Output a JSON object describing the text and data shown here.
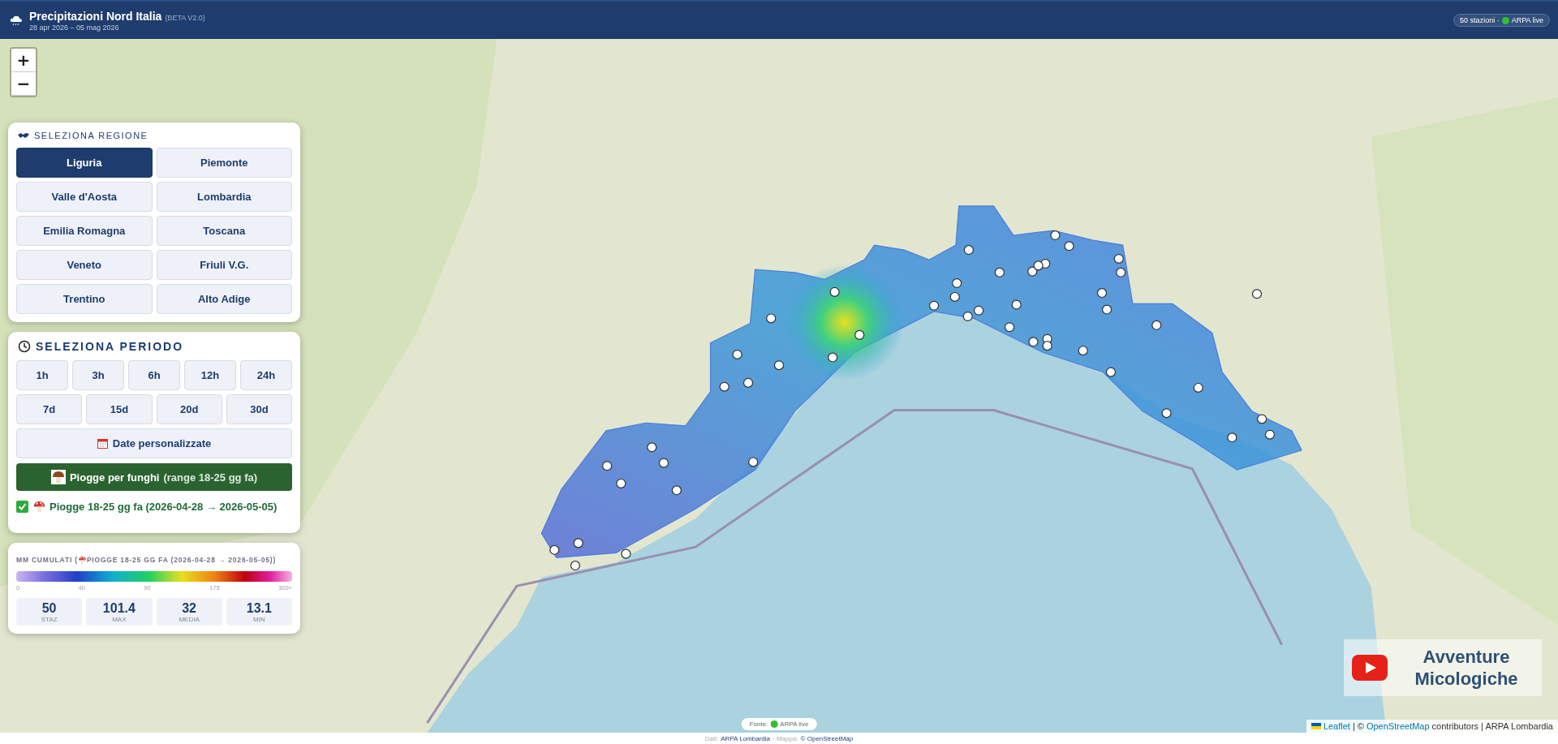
{
  "header": {
    "title": "Precipitazioni Nord Italia",
    "version": "(BETA V2.0)",
    "subtitle": "28 apr 2026 – 05 mag 2026",
    "stations": "50 stazioni ·",
    "source": "ARPA live"
  },
  "zoom_controls": [
    "+",
    "−"
  ],
  "region_panel": {
    "title": "SELEZIONA REGIONE",
    "regions": [
      {
        "label": "Liguria",
        "selected": true
      },
      {
        "label": "Piemonte",
        "selected": false
      },
      {
        "label": "Valle d'Aosta",
        "selected": false
      },
      {
        "label": "Lombardia",
        "selected": false
      },
      {
        "label": "Emilia Romagna",
        "selected": false
      },
      {
        "label": "Toscana",
        "selected": false
      },
      {
        "label": "Veneto",
        "selected": false
      },
      {
        "label": "Friuli V.G.",
        "selected": false
      },
      {
        "label": "Trentino",
        "selected": false
      },
      {
        "label": "Alto Adige",
        "selected": false
      }
    ]
  },
  "period_panel": {
    "title": "SELEZIONA PERIODO",
    "rows": [
      [
        {
          "label": "1h",
          "selected": false
        },
        {
          "label": "3h",
          "selected": false
        },
        {
          "label": "6h",
          "selected": false
        },
        {
          "label": "12h",
          "selected": false
        },
        {
          "label": "24h",
          "selected": false
        }
      ],
      [
        {
          "label": "7d",
          "selected": false
        },
        {
          "label": "15d",
          "selected": false
        },
        {
          "label": "20d",
          "selected": false
        },
        {
          "label": "30d",
          "selected": false
        }
      ]
    ],
    "custom_dates": "Date personalizzate",
    "fungi_button": {
      "label": "Piogge per funghi",
      "detail": "(range 18-25 gg fa)",
      "selected": true
    },
    "active_range": {
      "checked": true,
      "text": "Piogge 18-25 gg fa (2026-04-28 → 2026-05-05)"
    }
  },
  "legend": {
    "title_start": "MM CUMULATI (",
    "title_end": "PIOGGE 18-25 GG FA (2026-04-28 → 2026-05-05))",
    "ticks": [
      "0",
      "40",
      "90",
      "175",
      "300+"
    ],
    "stats": [
      {
        "value": "50",
        "label": "STAZ"
      },
      {
        "value": "101.4",
        "label": "MAX"
      },
      {
        "value": "32",
        "label": "MEDIA"
      },
      {
        "value": "13.1",
        "label": "MIN"
      }
    ]
  },
  "logo": {
    "text": "Avventure Micologiche"
  },
  "source_pill": {
    "label": "Fonte:",
    "source": "ARPA live"
  },
  "attribution": {
    "leaflet": "Leaflet",
    "separator": "| ©",
    "osm": "OpenStreetMap",
    "rest": "contributors | ARPA Lombardia"
  },
  "footer": {
    "data_label": "Dati:",
    "data_source": "ARPA Lombardia",
    "map_label": "· Mappa:",
    "map_source": "© OpenStreetMap"
  }
}
